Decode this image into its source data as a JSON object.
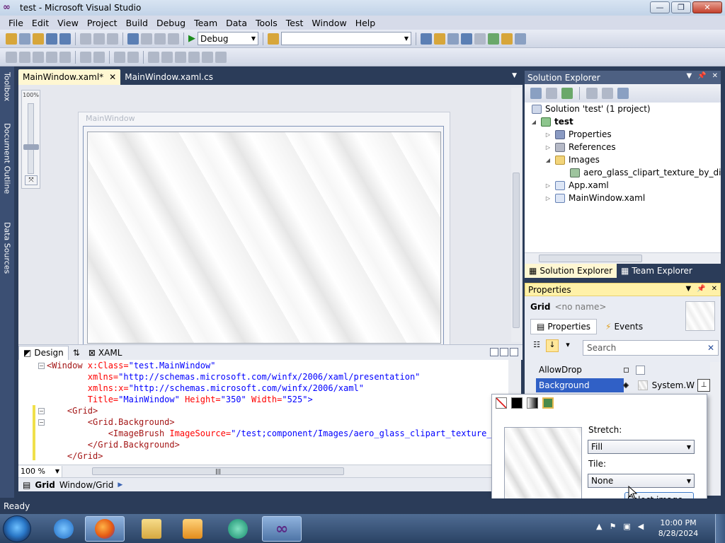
{
  "window": {
    "title": "test - Microsoft Visual Studio"
  },
  "menu": [
    "File",
    "Edit",
    "View",
    "Project",
    "Build",
    "Debug",
    "Team",
    "Data",
    "Tools",
    "Test",
    "Window",
    "Help"
  ],
  "toolbar": {
    "config": "Debug",
    "platform": ""
  },
  "left_strip": [
    "Toolbox",
    "Document Outline",
    "Data Sources"
  ],
  "doc_tabs": [
    {
      "label": "MainWindow.xaml*",
      "active": true
    },
    {
      "label": "MainWindow.xaml.cs",
      "active": false
    }
  ],
  "designer": {
    "zoom_pct": "100%",
    "window_title": "MainWindow"
  },
  "split": {
    "design_label": "Design",
    "swap_label": "⇅",
    "xaml_label": "XAML"
  },
  "code": {
    "l1_tag": "<Window",
    "l1_attr": " x:Class=",
    "l1_val": "\"test.MainWindow\"",
    "l2_attr": "        xmlns=",
    "l2_val": "\"http://schemas.microsoft.com/winfx/2006/xaml/presentation\"",
    "l3_attr": "        xmlns:x=",
    "l3_val": "\"http://schemas.microsoft.com/winfx/2006/xaml\"",
    "l4_attr": "        Title=",
    "l4_val": "\"MainWindow\"",
    "l4_attr2": " Height=",
    "l4_val2": "\"350\"",
    "l4_attr3": " Width=",
    "l4_val3": "\"525\"",
    "l4_end": ">",
    "l5": "    <Grid>",
    "l6": "        <Grid.Background>",
    "l7_tag": "            <ImageBrush",
    "l7_attr": " ImageSource=",
    "l7_val": "\"/test;component/Images/aero_glass_clipart_texture_by_",
    "l8": "        </Grid.Background>",
    "l9": "    </Grid>"
  },
  "editor_zoom": "100 %",
  "breadcrumb": {
    "element": "Grid",
    "path": "Window/Grid"
  },
  "solution_explorer": {
    "title": "Solution Explorer",
    "items": [
      {
        "label": "Solution 'test' (1 project)",
        "icon": "solution-icon"
      },
      {
        "label": "test",
        "icon": "project-icon",
        "bold": true
      },
      {
        "label": "Properties",
        "icon": "properties-icon"
      },
      {
        "label": "References",
        "icon": "references-icon"
      },
      {
        "label": "Images",
        "icon": "folder-icon"
      },
      {
        "label": "aero_glass_clipart_texture_by_diamo",
        "icon": "image-file-icon"
      },
      {
        "label": "App.xaml",
        "icon": "xaml-file-icon"
      },
      {
        "label": "MainWindow.xaml",
        "icon": "xaml-file-icon"
      }
    ],
    "tabs": [
      "Solution Explorer",
      "Team Explorer"
    ]
  },
  "properties": {
    "title": "Properties",
    "element_type": "Grid",
    "element_name": "<no name>",
    "tab_properties": "Properties",
    "tab_events": "Events",
    "search_placeholder": "Search",
    "rows": [
      {
        "name": "AllowDrop",
        "value": ""
      },
      {
        "name": "Background",
        "value": "System.W"
      }
    ]
  },
  "brush_editor": {
    "stretch_label": "Stretch:",
    "stretch_value": "Fill",
    "tile_label": "Tile:",
    "tile_value": "None",
    "select_button": "Select image..."
  },
  "status": {
    "text": "Ready"
  },
  "taskbar": {
    "time": "10:00 PM",
    "date": "8/28/2024"
  }
}
